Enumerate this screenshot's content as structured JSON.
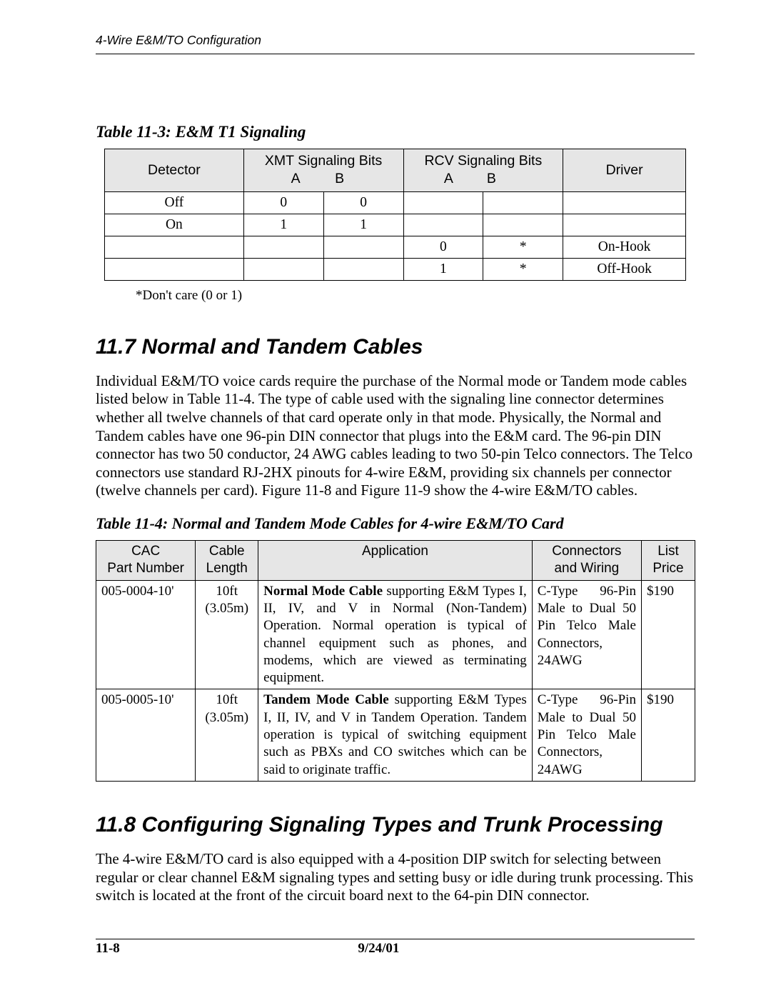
{
  "header": {
    "running": "4-Wire E&M/TO Configuration"
  },
  "table1": {
    "caption": "Table 11-3: E&M T1 Signaling",
    "head": {
      "detector": "Detector",
      "xmt": "XMT Signaling Bits",
      "rcv": "RCV Signaling Bits",
      "driver": "Driver",
      "a": "A",
      "b": "B"
    },
    "rows": [
      {
        "detector": "Off",
        "xa": "0",
        "xb": "0",
        "ra": "",
        "rb": "",
        "driver": ""
      },
      {
        "detector": "On",
        "xa": "1",
        "xb": "1",
        "ra": "",
        "rb": "",
        "driver": ""
      },
      {
        "detector": "",
        "xa": "",
        "xb": "",
        "ra": "0",
        "rb": "*",
        "driver": "On-Hook"
      },
      {
        "detector": "",
        "xa": "",
        "xb": "",
        "ra": "1",
        "rb": "*",
        "driver": "Off-Hook"
      }
    ],
    "footnote": "*Don't care (0 or 1)"
  },
  "section1": {
    "heading": "11.7  Normal and Tandem Cables",
    "para": "Individual E&M/TO voice cards require the purchase of the Normal mode or Tandem mode cables listed below in Table 11-4. The type of cable used with the signaling line connector determines whether all twelve channels of that card operate only in that mode. Physically, the Normal and Tandem cables have one 96-pin DIN connector that plugs into the E&M card. The 96-pin DIN connector has two 50 conductor, 24 AWG cables leading to two 50-pin Telco connectors. The Telco connectors use standard RJ-2HX pinouts for 4-wire E&M, providing six channels per connector (twelve channels per card). Figure 11-8 and Figure 11-9 show the 4-wire E&M/TO cables."
  },
  "table2": {
    "caption": "Table 11-4: Normal  and Tandem Mode Cables for 4-wire E&M/TO Card",
    "head": {
      "part_l1": "CAC",
      "part_l2": "Part Number",
      "len_l1": "Cable",
      "len_l2": "Length",
      "app": "Application",
      "conn_l1": "Connectors",
      "conn_l2": "and Wiring",
      "price_l1": "List",
      "price_l2": "Price"
    },
    "rows": [
      {
        "part": "005-0004-10'",
        "len_l1": "10ft",
        "len_l2": "(3.05m)",
        "app_bold": "Normal Mode Cable",
        "app_rest": " supporting E&M Types I, II, IV, and V in Normal (Non-Tandem) Operation. Normal operation is typical of channel equipment such as phones, and modems, which are viewed as terminating equipment.",
        "conn": "C-Type 96-Pin Male to Dual 50 Pin Telco Male Connectors, 24AWG",
        "price": "$190"
      },
      {
        "part": "005-0005-10'",
        "len_l1": "10ft",
        "len_l2": "(3.05m)",
        "app_bold": "Tandem Mode Cable",
        "app_rest": " supporting E&M Types I, II, IV, and V in Tandem Operation. Tandem operation is typical of switching equipment such as PBXs and CO switches which can be said to originate traffic.",
        "conn": "C-Type 96-Pin Male to Dual 50 Pin Telco Male Connectors, 24AWG",
        "price": "$190"
      }
    ]
  },
  "section2": {
    "heading": "11.8  Configuring Signaling Types and Trunk Processing",
    "para": "The 4-wire E&M/TO card is also equipped with a 4-position DIP switch for selecting between regular or clear channel E&M signaling types and setting busy or idle during trunk processing. This switch is located at the front of the circuit board next to the 64-pin DIN connector."
  },
  "footer": {
    "left": "11-8",
    "center": "9/24/01"
  }
}
